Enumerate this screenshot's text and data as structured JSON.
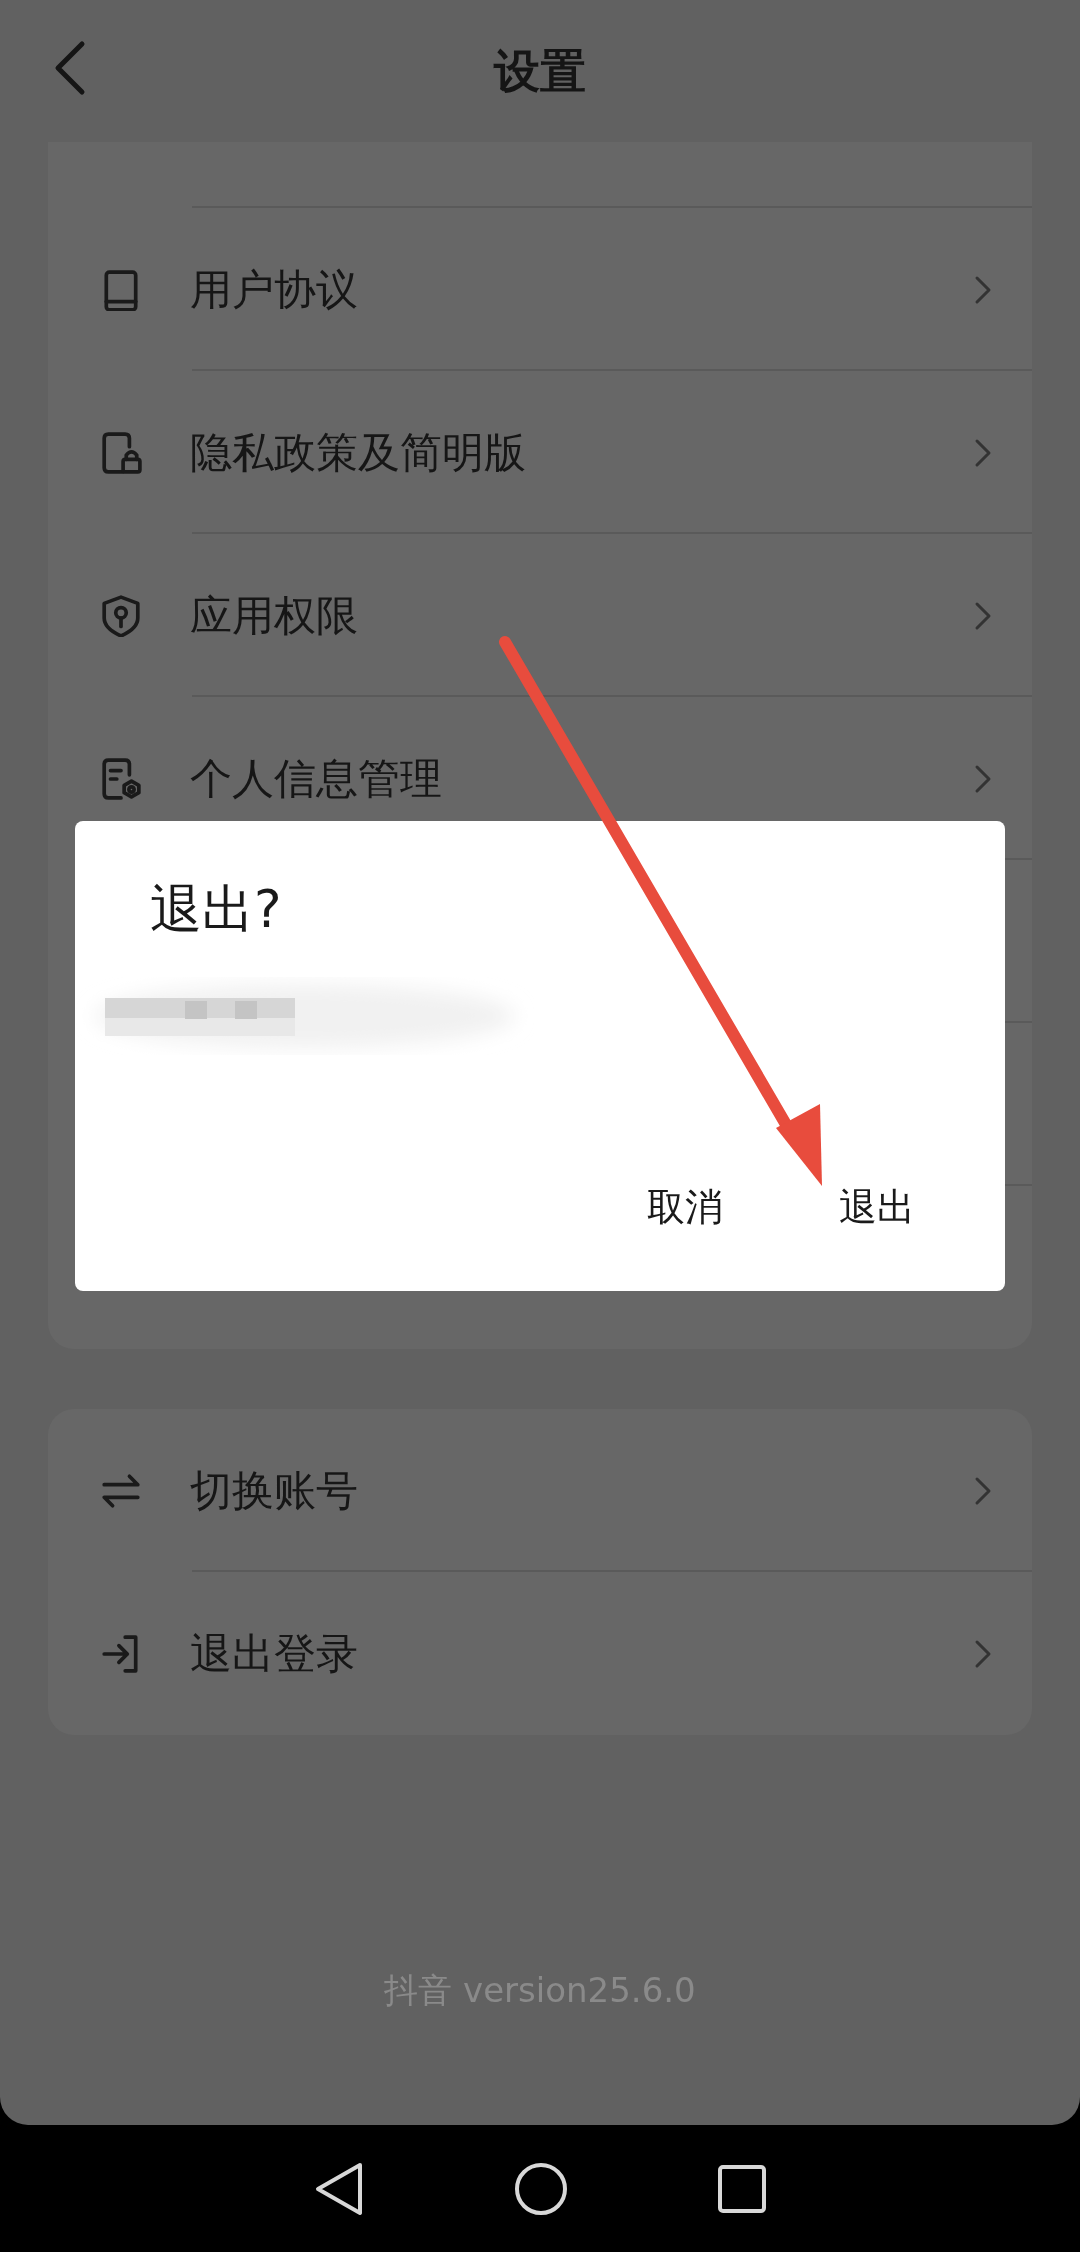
{
  "header": {
    "title": "设置"
  },
  "settings_items": [
    {
      "kind": "book",
      "label": "用户协议"
    },
    {
      "kind": "doc-lock",
      "label": "隐私政策及简明版"
    },
    {
      "kind": "shield",
      "label": "应用权限"
    },
    {
      "kind": "doc-gear",
      "label": "个人信息管理"
    }
  ],
  "account_items": [
    {
      "kind": "swap",
      "label": "切换账号"
    },
    {
      "kind": "logout",
      "label": "退出登录"
    }
  ],
  "footer": "抖音 version25.6.0",
  "dialog": {
    "title": "退出?",
    "buttons": [
      {
        "label": "取消"
      },
      {
        "label": "退出"
      }
    ]
  }
}
